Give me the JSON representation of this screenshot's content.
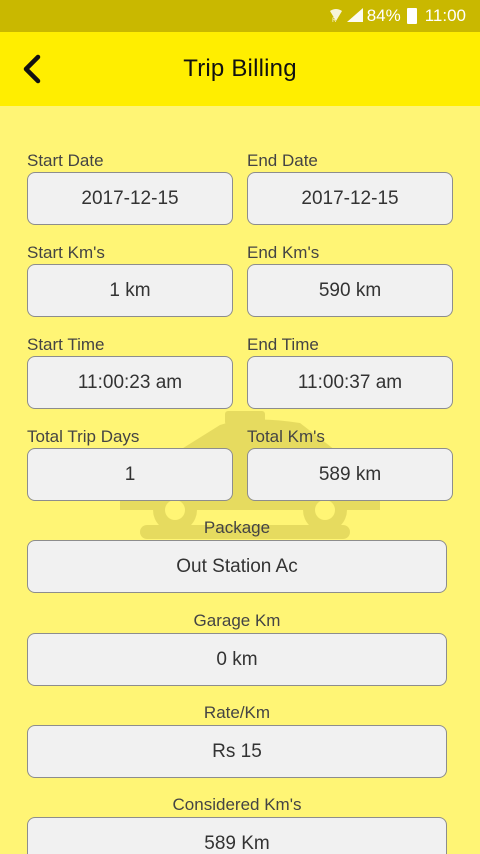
{
  "status_bar": {
    "battery": "84%",
    "time": "11:00",
    "icons": [
      "wifi-icon",
      "signal-icon",
      "battery-icon"
    ]
  },
  "header": {
    "title": "Trip Billing",
    "back_icon": "chevron-left-icon"
  },
  "fields": {
    "start_date": {
      "label": "Start Date",
      "value": "2017-12-15"
    },
    "end_date": {
      "label": "End Date",
      "value": "2017-12-15"
    },
    "start_km": {
      "label": "Start Km's",
      "value": "1 km"
    },
    "end_km": {
      "label": "End Km's",
      "value": "590 km"
    },
    "start_time": {
      "label": "Start Time",
      "value": "11:00:23 am"
    },
    "end_time": {
      "label": "End Time",
      "value": "11:00:37 am"
    },
    "total_trip_days": {
      "label": "Total Trip Days",
      "value": "1"
    },
    "total_km": {
      "label": "Total Km's",
      "value": "589 km"
    },
    "package": {
      "label": "Package",
      "value": "Out Station Ac"
    },
    "garage_km": {
      "label": "Garage Km",
      "value": "0 km"
    },
    "rate_km": {
      "label": "Rate/Km",
      "value": "Rs 15"
    },
    "considered_km": {
      "label": "Considered Km's",
      "value": "589 Km"
    }
  },
  "colors": {
    "status_bar": "#c9b800",
    "app_bar": "#ffee00",
    "background": "#fff575",
    "field_bg": "#f1f1f1",
    "field_border": "#8d8d8d"
  }
}
